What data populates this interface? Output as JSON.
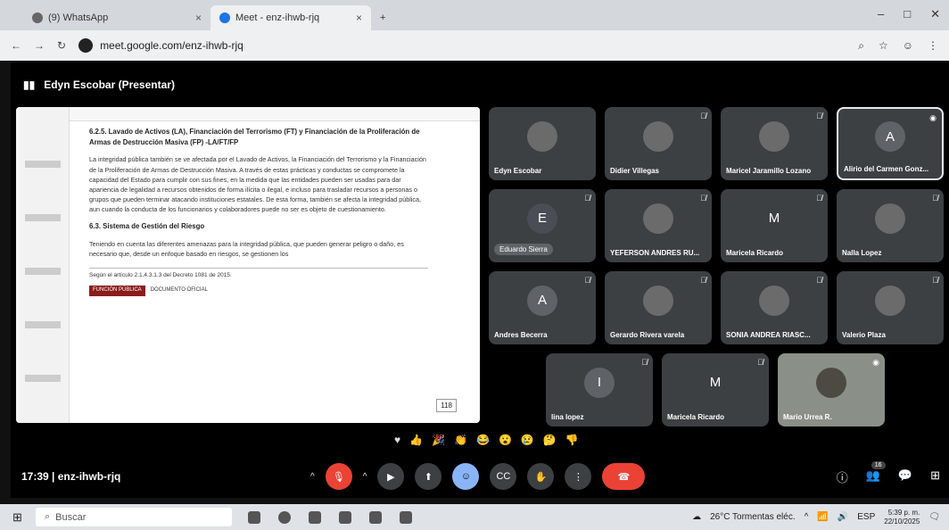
{
  "browser": {
    "tabs": [
      {
        "title": "(9) WhatsApp"
      },
      {
        "title": "Meet - enz-ihwb-rjq"
      }
    ],
    "new_tab": "+",
    "url": "meet.google.com/enz-ihwb-rjq"
  },
  "meet": {
    "presenter_label": "Edyn Escobar (Presentar)",
    "document": {
      "heading": "6.2.5. Lavado de Activos (LA), Financiación del Terrorismo (FT) y Financiación de la Proliferación de Armas de Destrucción Masiva (FP) -LA/FT/FP",
      "paragraph1": "La integridad pública también se ve afectada por el Lavado de Activos, la Financiación del Terrorismo y la Financiación de la Proliferación de Armas de Destrucción Masiva. A través de estas prácticas y conductas se compromete la capacidad del Estado para cumplir con sus fines, en la medida que las entidades pueden ser usadas para dar apariencia de legalidad a recursos obtenidos de forma ilícita o ilegal, e incluso para trasladar recursos a personas o grupos que pueden terminar atacando instituciones estatales. De esta forma, también se afecta la integridad pública, aun cuando la conducta de los funcionarios y colaboradores puede no ser es objeto de cuestionamiento.",
      "heading2": "6.3. Sistema de Gestión del Riesgo",
      "paragraph2": "Teniendo en cuenta las diferentes amenazas para la integridad pública, que pueden generar peligro o daño, es necesario que, desde un enfoque basado en riesgos, se gestionen los",
      "footnote": "Según el artículo 2.1.4.3.1.3 del Decreto 1081 de 2015.",
      "brand": "FUNCIÓN PÚBLICA",
      "brand2": "DOCUMENTO OFICIAL",
      "page_number": "118"
    },
    "participants": [
      {
        "name": "Edyn Escobar",
        "initial": ""
      },
      {
        "name": "Didier Villegas",
        "initial": ""
      },
      {
        "name": "Maricel Jaramillo Lozano",
        "initial": ""
      },
      {
        "name": "Alirio del Carmen Gonz...",
        "initial": "A"
      },
      {
        "name": "Eduardo Sierra",
        "initial": "E"
      },
      {
        "name": "YEFERSON ANDRES RU...",
        "initial": ""
      },
      {
        "name": "Maricela Ricardo",
        "initial": "M"
      },
      {
        "name": "Nalla Lopez",
        "initial": ""
      },
      {
        "name": "Andres Becerra",
        "initial": "A"
      },
      {
        "name": "Gerardo Rivera varela",
        "initial": ""
      },
      {
        "name": "SONIA ANDREA RIASC...",
        "initial": ""
      },
      {
        "name": "Valerio Plaza",
        "initial": ""
      },
      {
        "name": "lina lopez",
        "initial": "I"
      },
      {
        "name": "Maricela Ricardo",
        "initial": "M"
      },
      {
        "name": "Mario Urrea R.",
        "initial": ""
      }
    ],
    "meeting_info": "17:39 | enz-ihwb-rjq",
    "people_count": "16"
  },
  "taskbar": {
    "search_placeholder": "Buscar",
    "weather": "26°C Tormentas eléc.",
    "language": "ESP",
    "time": "5:39 p. m.",
    "date": "22/10/2025"
  }
}
